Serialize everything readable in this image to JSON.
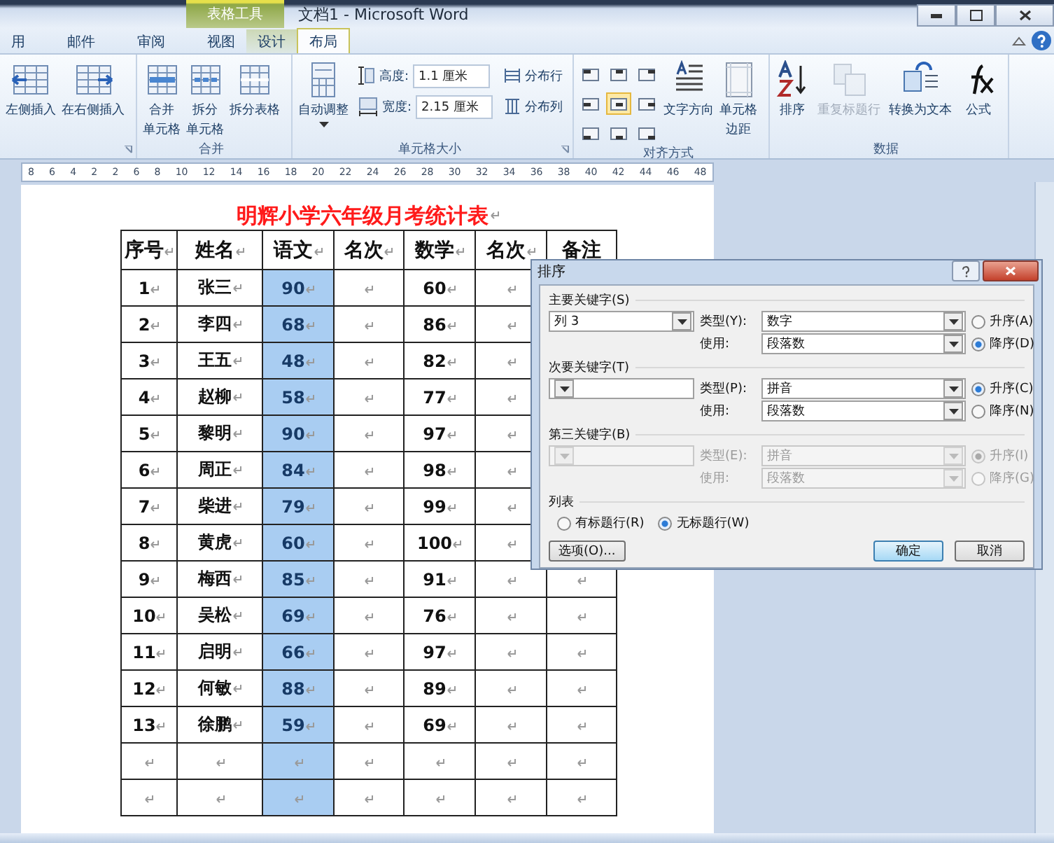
{
  "window": {
    "title": "文档1 - Microsoft Word",
    "context_tab": "表格工具"
  },
  "tabs": [
    {
      "label": "用",
      "selected": false
    },
    {
      "label": "邮件",
      "selected": false
    },
    {
      "label": "审阅",
      "selected": false
    },
    {
      "label": "视图",
      "selected": false
    },
    {
      "label": "设计",
      "selected": false,
      "kind": "context"
    },
    {
      "label": "布局",
      "selected": true,
      "kind": "context"
    }
  ],
  "ribbon": {
    "insert_group": {
      "buttons": [
        {
          "label": "左侧插入",
          "kind": "insert-left"
        },
        {
          "label": "在右侧插入",
          "kind": "insert-right"
        }
      ]
    },
    "merge_group": {
      "label": "合并",
      "buttons": [
        {
          "lines": [
            "合并",
            "单元格"
          ],
          "kind": "merge"
        },
        {
          "lines": [
            "拆分",
            "单元格"
          ],
          "kind": "split"
        },
        {
          "lines": [
            "拆分表格"
          ],
          "kind": "split-table"
        }
      ]
    },
    "cell_size_group": {
      "label": "单元格大小",
      "autofit": "自动调整",
      "height_label": "高度:",
      "height_value": "1.1 厘米",
      "width_label": "宽度:",
      "width_value": "2.15 厘米",
      "distribute_rows": "分布行",
      "distribute_columns": "分布列"
    },
    "align_group": {
      "label": "对齐方式",
      "alignments": [
        {
          "selected": false
        },
        {
          "selected": false
        },
        {
          "selected": false
        },
        {
          "selected": false
        },
        {
          "selected": true
        },
        {
          "selected": false
        },
        {
          "selected": false
        },
        {
          "selected": false
        },
        {
          "selected": false
        }
      ],
      "text_direction": "文字方向",
      "cell_margins": [
        "单元格",
        "边距"
      ]
    },
    "data_group": {
      "label": "数据",
      "buttons": [
        {
          "label": "排序",
          "kind": "sort",
          "disabled": false
        },
        {
          "label": "重复标题行",
          "kind": "repeat",
          "disabled": true
        },
        {
          "label": "转换为文本",
          "kind": "convert",
          "disabled": false
        },
        {
          "label": "公式",
          "kind": "formula",
          "disabled": false
        }
      ]
    }
  },
  "ruler": [
    "8",
    "6",
    "4",
    "2",
    "2",
    "6",
    "8",
    "10",
    "12",
    "14",
    "16",
    "18",
    "20",
    "22",
    "24",
    "26",
    "28",
    "30",
    "32",
    "34",
    "36",
    "38",
    "40",
    "42",
    "44",
    "46",
    "48"
  ],
  "document": {
    "title": "明辉小学六年级月考统计表",
    "columns": [
      {
        "label": "序号",
        "selected": false
      },
      {
        "label": "姓名",
        "selected": false
      },
      {
        "label": "语文",
        "selected": true
      },
      {
        "label": "名次",
        "selected": false
      },
      {
        "label": "数学",
        "selected": false
      },
      {
        "label": "名次",
        "selected": false
      },
      {
        "label": "备注",
        "selected": false
      }
    ],
    "rows": [
      {
        "no": "1",
        "name": "张三",
        "chinese": "90",
        "math": "60"
      },
      {
        "no": "2",
        "name": "李四",
        "chinese": "68",
        "math": "86"
      },
      {
        "no": "3",
        "name": "王五",
        "chinese": "48",
        "math": "82"
      },
      {
        "no": "4",
        "name": "赵柳",
        "chinese": "58",
        "math": "77"
      },
      {
        "no": "5",
        "name": "黎明",
        "chinese": "90",
        "math": "97"
      },
      {
        "no": "6",
        "name": "周正",
        "chinese": "84",
        "math": "98"
      },
      {
        "no": "7",
        "name": "柴进",
        "chinese": "79",
        "math": "99"
      },
      {
        "no": "8",
        "name": "黄虎",
        "chinese": "60",
        "math": "100"
      },
      {
        "no": "9",
        "name": "梅西",
        "chinese": "85",
        "math": "91"
      },
      {
        "no": "10",
        "name": "吴松",
        "chinese": "69",
        "math": "76"
      },
      {
        "no": "11",
        "name": "启明",
        "chinese": "66",
        "math": "97"
      },
      {
        "no": "12",
        "name": "何敏",
        "chinese": "88",
        "math": "89"
      },
      {
        "no": "13",
        "name": "徐鹏",
        "chinese": "59",
        "math": "69"
      },
      {},
      {}
    ]
  },
  "dialog": {
    "title": "排序",
    "keys": [
      {
        "label": "主要关键字(S)",
        "value": "列 3",
        "type_label": "类型(Y):",
        "type_value": "数字",
        "use_label": "使用:",
        "use_value": "段落数",
        "asc_label": "升序(A)",
        "desc_label": "降序(D)",
        "descending": true,
        "disabled": false
      },
      {
        "label": "次要关键字(T)",
        "type_label": "类型(P):",
        "type_value": "拼音",
        "use_label": "使用:",
        "use_value": "段落数",
        "asc_label": "升序(C)",
        "desc_label": "降序(N)",
        "descending": false,
        "disabled": false
      },
      {
        "label": "第三关键字(B)",
        "type_label": "类型(E):",
        "type_value": "拼音",
        "use_label": "使用:",
        "use_value": "段落数",
        "asc_label": "升序(I)",
        "desc_label": "降序(G)",
        "descending": false,
        "disabled": true
      }
    ],
    "list_label": "列表",
    "list_options": [
      {
        "label": "有标题行(R)",
        "selected": false
      },
      {
        "label": "无标题行(W)",
        "selected": true
      }
    ],
    "options_button": "选项(O)...",
    "ok_button": "确定",
    "cancel_button": "取消"
  }
}
